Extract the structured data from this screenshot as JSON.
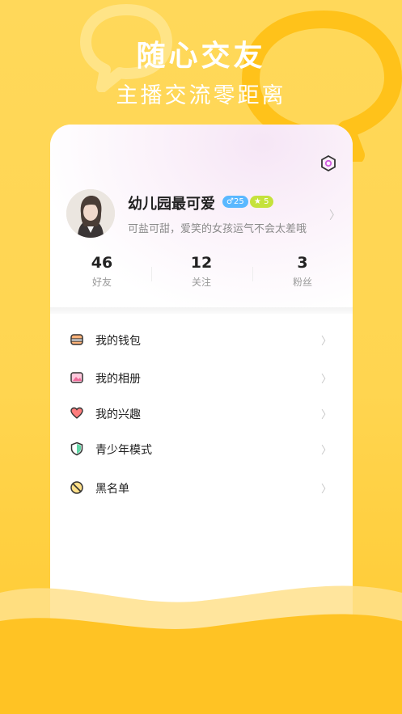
{
  "hero": {
    "title": "随心交友",
    "subtitle": "主播交流零距离"
  },
  "profile": {
    "name": "幼儿园最可爱",
    "gender_badge": "♂25",
    "level_badge": "★ 5",
    "bio": "可盐可甜，爱笑的女孩运气不会太差哦"
  },
  "stats": [
    {
      "value": "46",
      "label": "好友"
    },
    {
      "value": "12",
      "label": "关注"
    },
    {
      "value": "3",
      "label": "粉丝"
    }
  ],
  "menu": [
    {
      "label": "我的钱包",
      "icon": "wallet-icon"
    },
    {
      "label": "我的相册",
      "icon": "album-icon"
    },
    {
      "label": "我的兴趣",
      "icon": "heart-icon"
    },
    {
      "label": "青少年模式",
      "icon": "shield-icon"
    },
    {
      "label": "黑名单",
      "icon": "block-icon"
    }
  ],
  "colors": {
    "background": "#ffd550",
    "gender_badge": "#5ab8ff",
    "level_badge": "#c5e23c"
  }
}
